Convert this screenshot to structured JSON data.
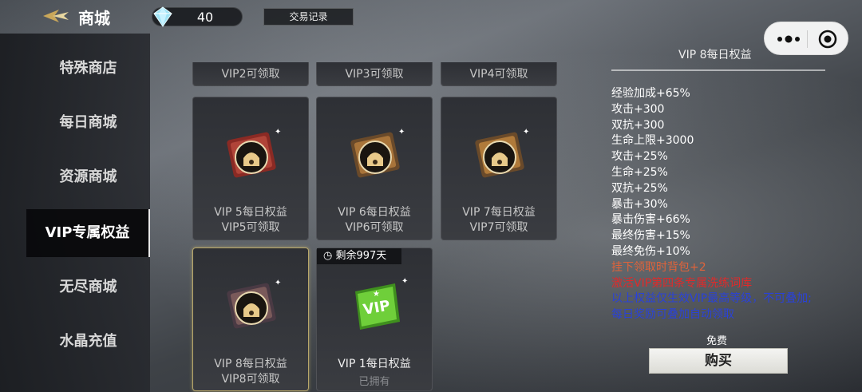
{
  "header": {
    "title": "商城",
    "gem_count": "40",
    "trade_label": "交易记录"
  },
  "sidebar": {
    "items": [
      {
        "label": "特殊商店"
      },
      {
        "label": "每日商城"
      },
      {
        "label": "资源商城"
      },
      {
        "label": "VIP专属权益",
        "active": true
      },
      {
        "label": "无尽商城"
      },
      {
        "label": "水晶充值"
      }
    ]
  },
  "grid": {
    "top_row": [
      "VIP2可领取",
      "VIP3可领取",
      "VIP4可领取"
    ],
    "cards": [
      {
        "name": "VIP 5每日权益",
        "sub": "VIP5可领取",
        "color": "#8a2a24"
      },
      {
        "name": "VIP 6每日权益",
        "sub": "VIP6可领取",
        "color": "#8a5a2a"
      },
      {
        "name": "VIP 7每日权益",
        "sub": "VIP7可领取",
        "color": "#8a5a2a"
      },
      {
        "name": "VIP 8每日权益",
        "sub": "VIP8可领取",
        "color": "#6a4a50"
      },
      {
        "name": "VIP 1每日权益",
        "owned": "已拥有",
        "timer": "剩余997天",
        "color": "#5fbf2a"
      }
    ]
  },
  "detail": {
    "title": "VIP 8每日权益",
    "lines": [
      {
        "text": "经验加成+65%",
        "style": "white"
      },
      {
        "text": "攻击+300",
        "style": "white"
      },
      {
        "text": "双抗+300",
        "style": "white"
      },
      {
        "text": "生命上限+3000",
        "style": "white"
      },
      {
        "text": "攻击+25%",
        "style": "white"
      },
      {
        "text": "生命+25%",
        "style": "white"
      },
      {
        "text": "双抗+25%",
        "style": "white"
      },
      {
        "text": "暴击+30%",
        "style": "white"
      },
      {
        "text": "暴击伤害+66%",
        "style": "white"
      },
      {
        "text": "最终伤害+15%",
        "style": "white"
      },
      {
        "text": "最终免伤+10%",
        "style": "white"
      },
      {
        "text": "挂下领取时背包+2",
        "style": "orange"
      },
      {
        "text": "激活VIP第四条专属洗练词库",
        "style": "red"
      },
      {
        "text": "以上权益仅生效VIP最高等级，不可叠加;",
        "style": "blue"
      },
      {
        "text": "每日奖励可叠加自动领取",
        "style": "blue"
      }
    ],
    "price": "免费",
    "buy_label": "购买"
  }
}
